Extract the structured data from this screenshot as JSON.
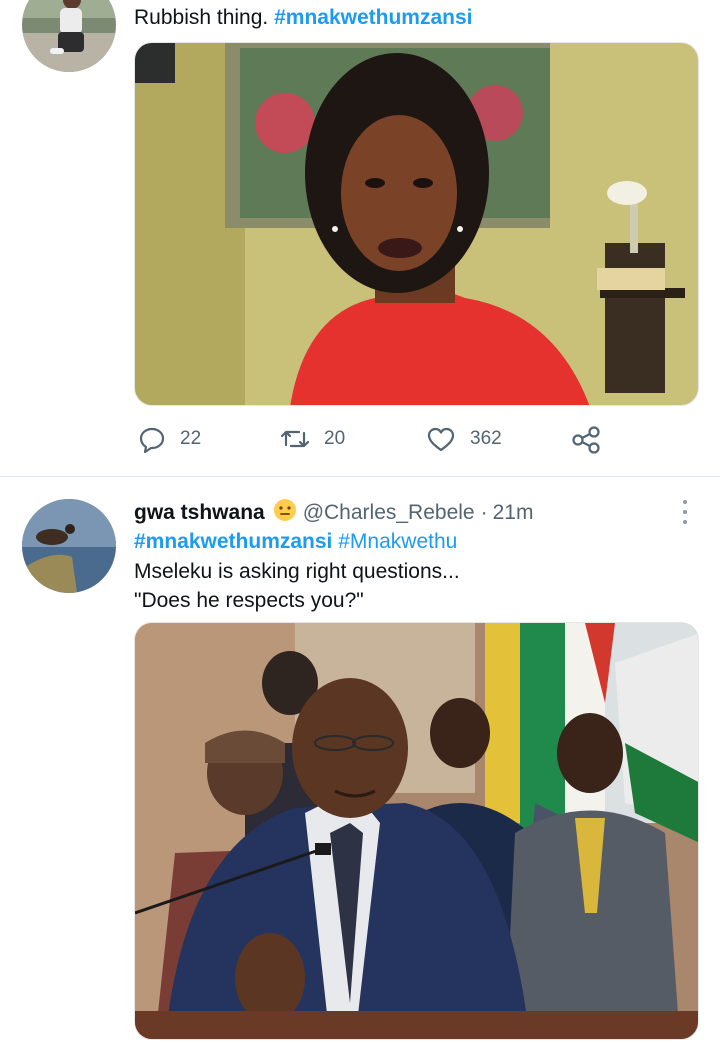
{
  "tweet1": {
    "text": "Rubbish thing.",
    "hashtag": "#mnakwethumzansi",
    "stats": {
      "replies": "22",
      "retweets": "20",
      "likes": "362"
    }
  },
  "tweet2": {
    "display_name": "gwa tshwana",
    "handle": "@Charles_Rebele",
    "separator": "·",
    "time": "21m",
    "hashtags": [
      "#mnakwethumzansi",
      "#Mnakwethu"
    ],
    "line1": "Mseleku is asking right questions...",
    "line2": "\"Does he respects you?\""
  },
  "colors": {
    "link": "#1d9bf0",
    "muted": "#536471",
    "divider": "#e1e6ea"
  },
  "icons": [
    "reply-icon",
    "retweet-icon",
    "like-icon",
    "share-icon",
    "more-icon",
    "emoji-icon"
  ]
}
